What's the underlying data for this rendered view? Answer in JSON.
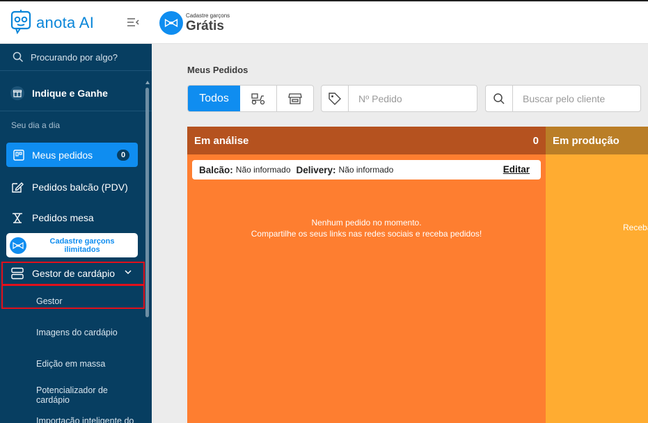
{
  "app": {
    "logo_text": "anota AI"
  },
  "sidebar": {
    "search_placeholder": "Procurando por algo?",
    "indique": "Indique e Ganhe",
    "section_label": "Seu dia a dia",
    "meus_pedidos": "Meus pedidos",
    "meus_pedidos_count": "0",
    "pedidos_balcao": "Pedidos balcão (PDV)",
    "pedidos_mesa": "Pedidos mesa",
    "promo_line1": "Cadastre garçons",
    "promo_line2": "ilimitados",
    "gestor_cardapio": "Gestor de cardápio",
    "sub_items": [
      "Gestor",
      "Imagens do cardápio",
      "Edição em massa",
      "Potencializador de",
      "cardápio",
      "Importação inteligente do"
    ]
  },
  "header": {
    "small": "Cadastre garçons",
    "big": "Grátis"
  },
  "main": {
    "title": "Meus Pedidos",
    "filter_all": "Todos",
    "order_placeholder": "Nº Pedido",
    "client_placeholder": "Buscar pelo cliente"
  },
  "columns": {
    "analysis": {
      "title": "Em análise",
      "count": "0",
      "balcao_label": "Balcão:",
      "balcao_value": "Não informado",
      "delivery_label": "Delivery:",
      "delivery_value": "Não informado",
      "edit": "Editar",
      "empty_line1": "Nenhum pedido no momento.",
      "empty_line2": "Compartilhe os seus links nas redes sociais e receba pedidos!"
    },
    "production": {
      "title": "Em produção",
      "partial_text": "Receba"
    }
  },
  "colors": {
    "sidebar_bg": "#073e61",
    "accent": "#0f8df0",
    "analysis_bg": "#fe7e30",
    "analysis_head": "#b5521f",
    "production_bg": "#ffac31",
    "production_head": "#ba7e27"
  },
  "icons": [
    "robot-logo-icon",
    "collapse-menu-icon",
    "search-icon",
    "gift-icon",
    "orders-icon",
    "edit-icon",
    "table-icon",
    "waiter-bowtie-icon",
    "menu-manager-icon",
    "chevron-down-icon",
    "delivery-scooter-icon",
    "store-icon",
    "tag-icon"
  ]
}
